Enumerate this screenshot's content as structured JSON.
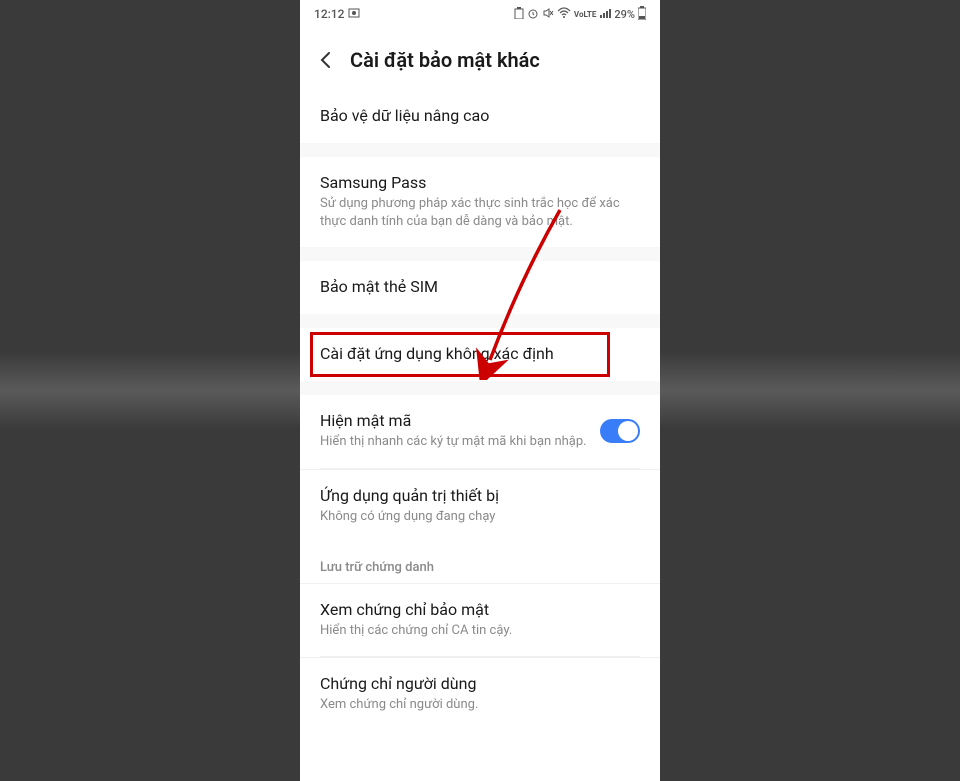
{
  "status": {
    "time": "12:12",
    "battery_pct": "29%"
  },
  "header": {
    "title": "Cài đặt bảo mật khác"
  },
  "items": {
    "advanced_protection": {
      "title": "Bảo vệ dữ liệu nâng cao"
    },
    "samsung_pass": {
      "title": "Samsung Pass",
      "subtitle": "Sử dụng phương pháp xác thực sinh trắc học để xác thực danh tính của bạn dễ dàng và bảo mật."
    },
    "sim_security": {
      "title": "Bảo mật thẻ SIM"
    },
    "unknown_apps": {
      "title": "Cài đặt ứng dụng không xác định"
    },
    "show_password": {
      "title": "Hiện mật mã",
      "subtitle": "Hiển thị nhanh các ký tự mật mã khi bạn nhập."
    },
    "device_admin": {
      "title": "Ứng dụng quản trị thiết bị",
      "subtitle": "Không có ứng dụng đang chạy"
    },
    "credential_header": "Lưu trữ chứng danh",
    "view_cert": {
      "title": "Xem chứng chỉ bảo mật",
      "subtitle": "Hiển thị các chứng chỉ CA tin cậy."
    },
    "user_cert": {
      "title": "Chứng chỉ người dùng",
      "subtitle": "Xem chứng chỉ người dùng."
    }
  }
}
